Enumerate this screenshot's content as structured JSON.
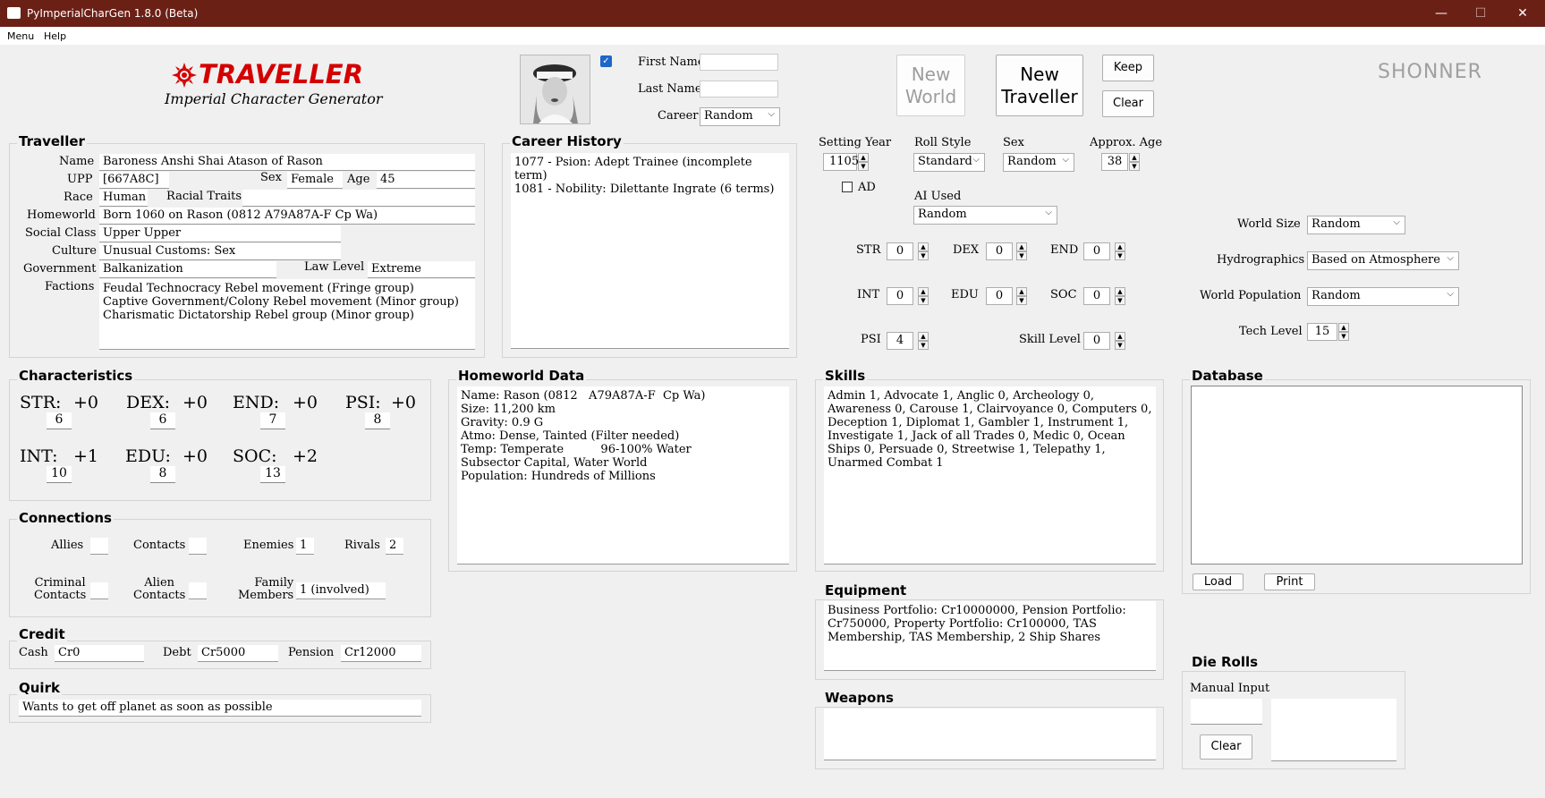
{
  "window": {
    "title": "PyImperialCharGen 1.8.0 (Beta)",
    "minimize": "—",
    "maximize": "☐",
    "close": "✕"
  },
  "menu": {
    "menu": "Menu",
    "help": "Help"
  },
  "logo": {
    "title": "TRAVELLER",
    "subtitle": "Imperial Character Generator",
    "brand": "SHONNER"
  },
  "names": {
    "first_label": "First Name",
    "first_value": "",
    "last_label": "Last Name",
    "last_value": "",
    "career_label": "Career",
    "career_value": "Random",
    "portrait_checked": true
  },
  "buttons": {
    "new_world": "New World",
    "new_traveller": "New Traveller",
    "keep": "Keep",
    "clear": "Clear",
    "load": "Load",
    "print": "Print",
    "die_clear": "Clear"
  },
  "traveller": {
    "heading": "Traveller",
    "name_label": "Name",
    "name": "Baroness Anshi Shai Atason of Rason",
    "upp_label": "UPP",
    "upp": "[667A8C]",
    "sex_label": "Sex",
    "sex": "Female",
    "age_label": "Age",
    "age": "45",
    "race_label": "Race",
    "race": "Human",
    "racial_traits_label": "Racial Traits",
    "racial_traits": "",
    "homeworld_label": "Homeworld",
    "homeworld": "Born 1060 on Rason (0812   A79A87A-F  Cp Wa)",
    "social_label": "Social Class",
    "social": "Upper Upper",
    "culture_label": "Culture",
    "culture": "Unusual Customs: Sex",
    "government_label": "Government",
    "government": "Balkanization",
    "law_label": "Law Level",
    "law": "Extreme",
    "factions_label": "Factions",
    "factions": "Feudal Technocracy Rebel movement (Fringe group)\nCaptive Government/Colony Rebel movement (Minor group)\nCharismatic Dictatorship Rebel group (Minor group)"
  },
  "career_history": {
    "heading": "Career History",
    "text": "1077 - Psion: Adept Trainee (incomplete term)\n1081 - Nobility: Dilettante Ingrate (6 terms)"
  },
  "settings": {
    "year_label": "Setting Year",
    "year": "1105",
    "ad_label": "AD",
    "roll_label": "Roll Style",
    "roll": "Standard",
    "sex_label": "Sex",
    "sex": "Random",
    "age_label": "Approx. Age",
    "age": "38",
    "ai_label": "AI Used",
    "ai": "Random",
    "str_label": "STR",
    "str": "0",
    "dex_label": "DEX",
    "dex": "0",
    "end_label": "END",
    "end": "0",
    "int_label": "INT",
    "int": "0",
    "edu_label": "EDU",
    "edu": "0",
    "soc_label": "SOC",
    "soc": "0",
    "psi_label": "PSI",
    "psi": "4",
    "skill_label": "Skill Level",
    "skill": "0"
  },
  "world": {
    "size_label": "World Size",
    "size": "Random",
    "hydro_label": "Hydrographics",
    "hydro": "Based on Atmosphere",
    "pop_label": "World Population",
    "pop": "Random",
    "tech_label": "Tech Level",
    "tech": "15"
  },
  "characteristics": {
    "heading": "Characteristics",
    "str_name": "STR:",
    "str_mod": "+0",
    "str_val": "6",
    "dex_name": "DEX:",
    "dex_mod": "+0",
    "dex_val": "6",
    "end_name": "END:",
    "end_mod": "+0",
    "end_val": "7",
    "psi_name": "PSI:",
    "psi_mod": "+0",
    "psi_val": "8",
    "int_name": "INT:",
    "int_mod": "+1",
    "int_val": "10",
    "edu_name": "EDU:",
    "edu_mod": "+0",
    "edu_val": "8",
    "soc_name": "SOC:",
    "soc_mod": "+2",
    "soc_val": "13"
  },
  "homeworld_data": {
    "heading": "Homeworld Data",
    "text": "Name: Rason (0812   A79A87A-F  Cp Wa)\nSize: 11,200 km\nGravity: 0.9 G\nAtmo: Dense, Tainted (Filter needed)\nTemp: Temperate          96-100% Water\nSubsector Capital, Water World\nPopulation: Hundreds of Millions"
  },
  "skills": {
    "heading": "Skills",
    "text": "Admin 1,   Advocate 1,   Anglic 0,   Archeology 0,   Awareness 0,   Carouse 1,   Clairvoyance 0,   Computers 0,   Deception 1,   Diplomat 1,   Gambler 1,   Instrument 1,   Investigate 1,   Jack of all Trades 0,   Medic 0,   Ocean Ships 0,   Persuade 0,   Streetwise 1,   Telepathy 1,   Unarmed Combat 1"
  },
  "database": {
    "heading": "Database",
    "text": ""
  },
  "connections": {
    "heading": "Connections",
    "allies_label": "Allies",
    "allies": "",
    "contacts_label": "Contacts",
    "contacts": "",
    "enemies_label": "Enemies",
    "enemies": "1",
    "rivals_label": "Rivals",
    "rivals": "2",
    "criminal_label": "Criminal\nContacts",
    "criminal": "",
    "alien_label": "Alien\nContacts",
    "alien": "",
    "family_label": "Family\nMembers",
    "family": "1 (involved)"
  },
  "credit": {
    "heading": "Credit",
    "cash_label": "Cash",
    "cash": "Cr0",
    "debt_label": "Debt",
    "debt": "Cr5000",
    "pension_label": "Pension",
    "pension": "Cr12000"
  },
  "quirk": {
    "heading": "Quirk",
    "text": "Wants to get off planet as soon as possible"
  },
  "equipment": {
    "heading": "Equipment",
    "text": "Business Portfolio: Cr10000000,   Pension Portfolio: Cr750000,   Property Portfolio: Cr100000,   TAS Membership,   TAS Membership,   2 Ship Shares"
  },
  "weapons": {
    "heading": "Weapons",
    "text": ""
  },
  "die_rolls": {
    "heading": "Die Rolls",
    "manual_label": "Manual Input",
    "manual_value": "",
    "output": ""
  },
  "colors": {
    "titlebar": "#6b2016",
    "logo_red": "#d40000",
    "brand_gray": "#a0a0a0"
  }
}
